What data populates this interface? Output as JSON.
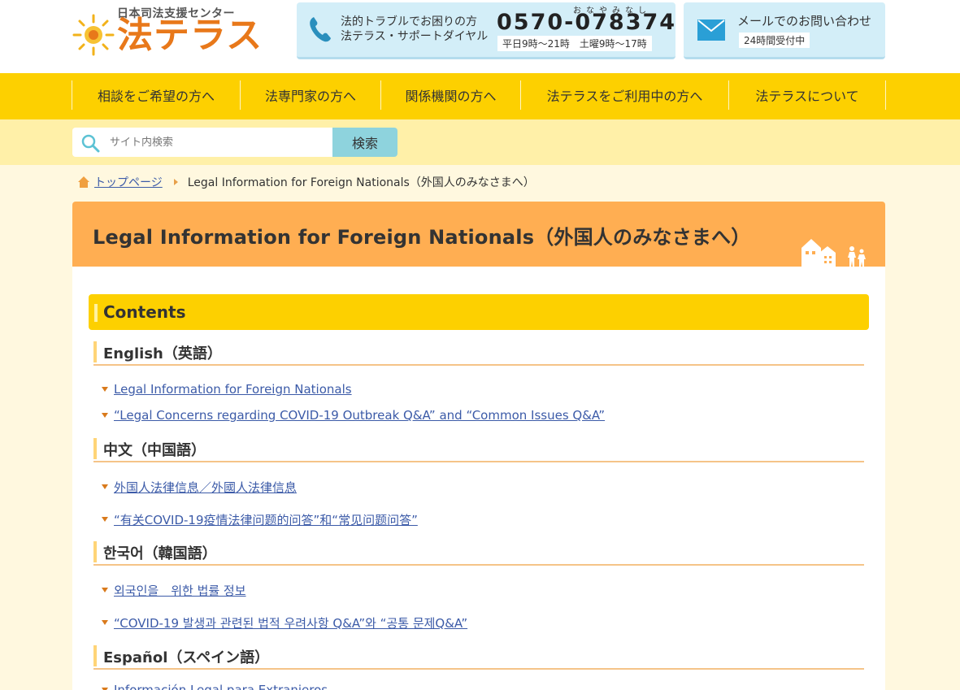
{
  "header": {
    "logo_subtitle": "日本司法支援センター",
    "logo_name": "法テラス",
    "phone": {
      "label_line1": "法的トラブルでお困りの方",
      "label_line2": "法テラス・サポートダイヤル",
      "ruby": "おなやみなし",
      "number": "0570-078374",
      "hours": "平日9時～21時　土曜9時～17時"
    },
    "mail": {
      "label": "メールでのお問い合わせ",
      "hours": "24時間受付中"
    }
  },
  "nav": {
    "items": [
      {
        "label": "相談をご希望の方へ"
      },
      {
        "label": "法専門家の方へ"
      },
      {
        "label": "関係機関の方へ"
      },
      {
        "label": "法テラスをご利用中の方へ"
      },
      {
        "label": "法テラスについて"
      }
    ]
  },
  "search": {
    "placeholder": "サイト内検索",
    "button_label": "検索"
  },
  "breadcrumb": {
    "home": "トップページ",
    "current": "Legal Information for Foreign Nationals（外国人のみなさまへ）"
  },
  "page": {
    "title": "Legal Information for Foreign Nationals（外国人のみなさまへ）"
  },
  "contents": {
    "heading": "Contents",
    "sections": [
      {
        "title": "English（英語）",
        "links": [
          "Legal Information for Foreign Nationals",
          "“Legal Concerns regarding COVID-19 Outbreak Q&A” and “Common Issues Q&A”"
        ]
      },
      {
        "title": "中文（中国語）",
        "links": [
          "外国人法律信息／外國人法律信息",
          "“有关COVID-19疫情法律问题的问答”和“常见问题问答”"
        ]
      },
      {
        "title": "한국어（韓国語）",
        "links": [
          "외국인을　위한 법률 정보",
          "“COVID-19 발생과 관련된 법적 우려사항 Q&A”와 “공통 문제Q&A”"
        ]
      },
      {
        "title": "Español（スペイン語）",
        "links": [
          "Información Legal para Extranjeros"
        ]
      }
    ]
  },
  "colors": {
    "nav_yellow": "#fdd000",
    "search_band": "#fff0a8",
    "title_orange": "#ffae52",
    "link_blue": "#3c5ba8",
    "accent_orange": "#d97a1c",
    "info_box_blue": "#d3eef8"
  }
}
